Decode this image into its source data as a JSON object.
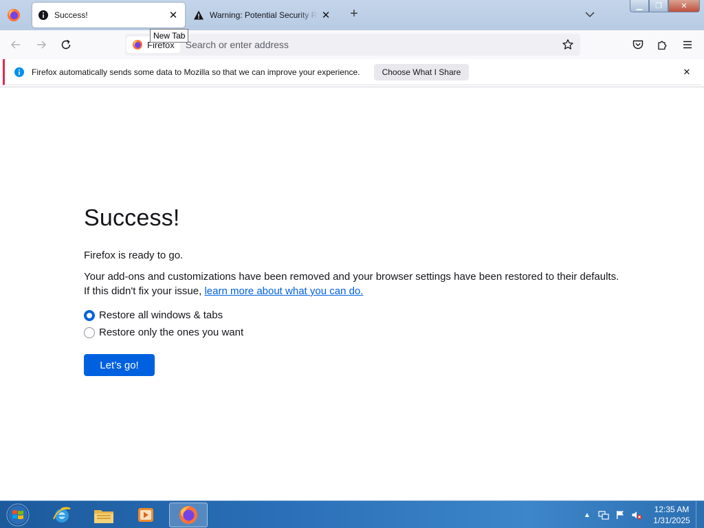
{
  "tabs": [
    {
      "title": "Success!",
      "active": true,
      "icon": "info-icon"
    },
    {
      "title": "Warning: Potential Security Risk Ahead",
      "active": false,
      "icon": "warning-icon"
    }
  ],
  "tooltip": "New Tab",
  "urlbar": {
    "identity_label": "Firefox",
    "placeholder": "Search or enter address",
    "value": ""
  },
  "notification": {
    "text": "Firefox automatically sends some data to Mozilla so that we can improve your experience.",
    "button_label": "Choose What I Share",
    "accent_color": "#e22850"
  },
  "page": {
    "title": "Success!",
    "ready_text": "Firefox is ready to go.",
    "description": "Your add-ons and customizations have been removed and your browser settings have been restored to their defaults.",
    "help_prefix": "If this didn't fix your issue,",
    "help_link": "learn more about what you can do.",
    "options": [
      {
        "label": "Restore all windows & tabs",
        "checked": true
      },
      {
        "label": "Restore only the ones you want",
        "checked": false
      }
    ],
    "button_label": "Let’s go!",
    "accent_color": "#0061e0"
  },
  "taskbar": {
    "apps": [
      "internet-explorer-icon",
      "file-explorer-icon",
      "media-player-icon",
      "firefox-icon"
    ],
    "active_app": "firefox-icon",
    "time": "12:35 AM",
    "date": "1/31/2025"
  }
}
